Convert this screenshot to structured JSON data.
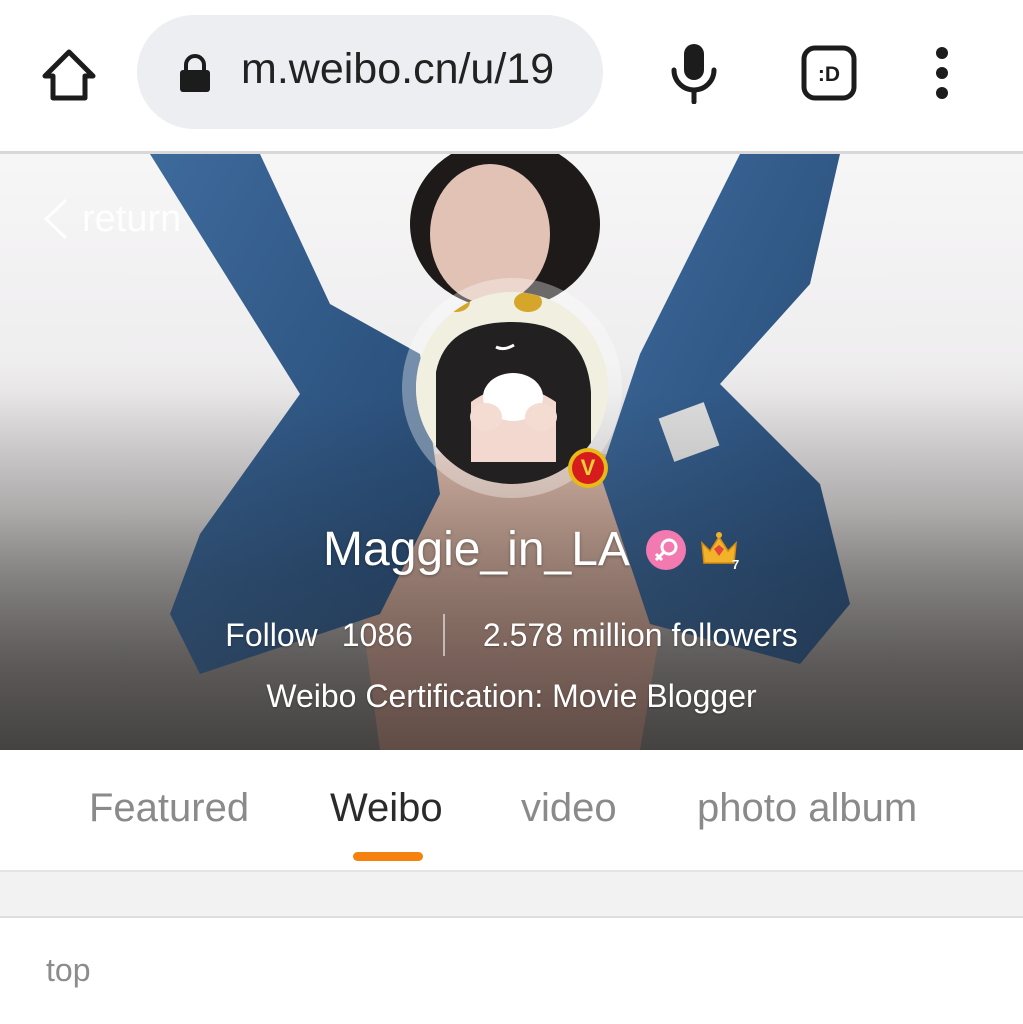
{
  "browser": {
    "url": "m.weibo.cn/u/19",
    "icons": {
      "home": "home-icon",
      "lock": "lock-icon",
      "mic": "microphone-icon",
      "tabs": "tab-switcher-icon",
      "tabs_label": ":D",
      "menu": "more-vert-icon"
    }
  },
  "profile": {
    "return_label": "return",
    "username": "Maggie_in_LA",
    "verified_badge": "V",
    "gender_icon": "female-icon",
    "member_badge": "crown-icon",
    "member_level": "7",
    "follow_label": "Follow",
    "follow_count": "1086",
    "followers_text": "2.578 million followers",
    "certification": "Weibo Certification: Movie Blogger"
  },
  "tabs": [
    {
      "label": "Featured",
      "active": false
    },
    {
      "label": "Weibo",
      "active": true
    },
    {
      "label": "video",
      "active": false
    },
    {
      "label": "photo album",
      "active": false
    }
  ],
  "feed": {
    "top_label": "top"
  },
  "colors": {
    "accent": "#f5820e",
    "verified_red": "#d61c1c",
    "gender_pink": "#f27ab0"
  }
}
